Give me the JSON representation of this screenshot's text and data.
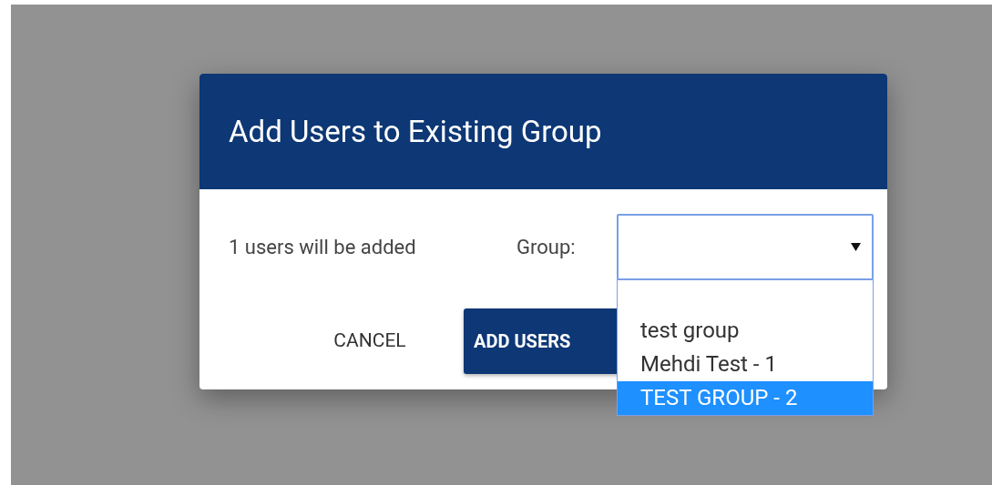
{
  "dialog": {
    "title": "Add Users to Existing Group",
    "message": "1 users will be added",
    "group_label": "Group:",
    "group_select": {
      "expanded": true,
      "options": [
        {
          "label": "test group",
          "selected": false
        },
        {
          "label": "Mehdi Test - 1",
          "selected": false
        },
        {
          "label": "TEST GROUP - 2",
          "selected": true
        }
      ]
    },
    "buttons": [
      {
        "label": "CANCEL",
        "kind": "text"
      },
      {
        "label": "ADD USERS",
        "kind": "primary"
      }
    ]
  }
}
